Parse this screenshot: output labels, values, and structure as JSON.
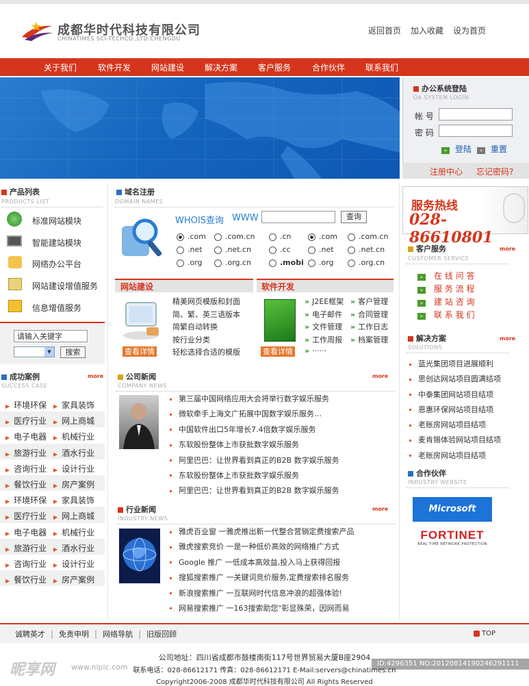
{
  "header": {
    "company_cn": "成都华时代科技有限公司",
    "company_en": "CHINATIMES SCI-TECHCO.,LTD.CHENGDU",
    "links": [
      "返回首页",
      "加入收藏",
      "设为首页"
    ]
  },
  "nav": [
    "关于我们",
    "软件开发",
    "网站建设",
    "解决方案",
    "客户服务",
    "合作伙伴",
    "联系我们"
  ],
  "login": {
    "title": "办公系统登陆",
    "subtitle": "OA SYSTEM LOGIN",
    "account_label": "帐 号",
    "password_label": "密 码",
    "login_btn": "登陆",
    "reset_btn": "重置",
    "register": "注册中心",
    "forgot": "忘记密码?"
  },
  "products": {
    "title": "产品列表",
    "subtitle": "PRODUCTS LIST",
    "items": [
      "标准网站模块",
      "智能建站模块",
      "网络办公平台",
      "网站建设增值服务",
      "信息增值服务"
    ]
  },
  "search": {
    "placeholder_value": "请输入关键字",
    "button": "搜索"
  },
  "domain": {
    "title": "域名注册",
    "subtitle": "DOMAIN NAMES",
    "whois": "WHOIS查询",
    "www": "WWW",
    "query_btn": "查询",
    "ext_rows": [
      [
        ".com",
        ".com.cn",
        ".cn",
        ".com",
        ".com.cn"
      ],
      [
        ".net",
        ".net.cn",
        ".cc",
        ".net",
        ".net.cn"
      ],
      [
        ".org",
        ".org.cn",
        ".mobi",
        ".org",
        ".org.cn"
      ]
    ]
  },
  "web_build": {
    "title": "网站建设",
    "items": [
      "精美网页模版和封面",
      "简、繁、英三语版本",
      "简繁自动转换",
      "按行业分类",
      "轻松选择合适的模版"
    ],
    "detail_btn": "查看详情"
  },
  "software": {
    "title": "软件开发",
    "items_left": [
      "J2EE框架",
      "电子邮件",
      "文件管理",
      "工作周报",
      "······"
    ],
    "items_right": [
      "客户管理",
      "合同管理",
      "工作日志",
      "档案管理"
    ],
    "detail_btn": "查看详情"
  },
  "hotline": {
    "label": "服务热线",
    "number": "028-86610801"
  },
  "customer_service": {
    "title": "客户服务",
    "subtitle": "CUSTOMER SERVICE",
    "more": "more",
    "items": [
      "在 线 问 答",
      "服 务 流 程",
      "建 站 咨 询",
      "联 系 我 们"
    ]
  },
  "solutions": {
    "title": "解决方案",
    "subtitle": "SOLUTIONS",
    "more": "more",
    "items": [
      "蓝光集团项目进展顺利",
      "思创达网站项目圆满结项",
      "中泰集团网站项目结项",
      "恩惠环保网站项目结项",
      "老账房网站项目结项",
      "麦肯锡体验网站项目结项",
      "老账房网站项目结项"
    ]
  },
  "partners": {
    "title": "合作伙伴",
    "subtitle": "INDUSTRY WEBSITE",
    "ms": "Microsoft",
    "fortinet": "FORTINET",
    "fortinet_sub": "REAL TIME NETWORK PROTECTION"
  },
  "cases": {
    "title": "成功案例",
    "subtitle": "SUCCESS CASE",
    "more": "more",
    "rows": [
      [
        "环境环保",
        "家具装饰"
      ],
      [
        "医疗行业",
        "网上商城"
      ],
      [
        "电子电器",
        "机械行业"
      ],
      [
        "旅游行业",
        "酒水行业"
      ],
      [
        "咨询行业",
        "设计行业"
      ],
      [
        "餐饮行业",
        "房产案例"
      ],
      [
        "环境环保",
        "家具装饰"
      ],
      [
        "医疗行业",
        "网上商城"
      ],
      [
        "电子电器",
        "机械行业"
      ],
      [
        "旅游行业",
        "酒水行业"
      ],
      [
        "咨询行业",
        "设计行业"
      ],
      [
        "餐饮行业",
        "房产案例"
      ]
    ]
  },
  "company_news": {
    "title": "公司新闻",
    "subtitle": "COMPANY NEWS",
    "more": "more",
    "items": [
      "第三届中国网络应用大会将举行数字娱乐服务",
      "微软牵手上海文广拓展中国数字娱乐服务…",
      "中国软件出口5年增长7.4倍数字娱乐服务",
      "东软股份整体上市获批数字娱乐服务",
      "阿里巴巴：让世界看到真正的B2B 数字娱乐服务",
      "东软股份整体上市获批数字娱乐服务",
      "阿里巴巴：让世界看到真正的B2B 数字娱乐服务"
    ]
  },
  "industry_news": {
    "title": "行业新闻",
    "subtitle": "INDUSTRY NEWS",
    "more": "more",
    "items": [
      "雅虎百业窗 一雅虎推出新一代整合营销定费搜索产品",
      "雅虎搜索竞价 一是一种低价高效的网络推广方式",
      "Google 推广 一低成本高效益,投入马上获得回报",
      "搜狐搜索推广 一关键词竞价服务,定费搜索排名服务",
      "新浪搜索推广 一互联网时代信息冲浪的超强体验!",
      "网易搜索推广 一163搜索助您\"彰显殊荣，因网而易"
    ]
  },
  "footer": {
    "links": [
      "诚聘英才",
      "免责申明",
      "网络导航",
      "旧版回顾"
    ],
    "top": "TOP",
    "address": "公司地址：四川省成都市鼓楼南街117号世界贸易大厦B座2904",
    "contact": "联系电话：028-86612171  传真：028-86612171  E-Mail:servers@chinatimes.cn",
    "copyright": "Copyright2006-2008 成都华时代科技有限公司 All Rights Reserved"
  },
  "watermark": {
    "site": "昵享网",
    "url": "www.nipic.com",
    "id": "ID:4296351 NO:20120814190246291111"
  }
}
